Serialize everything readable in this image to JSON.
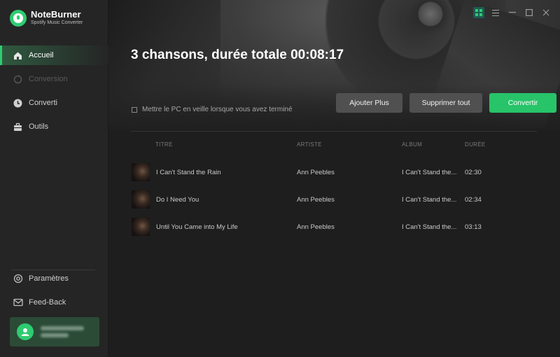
{
  "brand": {
    "name": "NoteBurner",
    "subtitle": "Spotify Music Converter"
  },
  "nav": {
    "accueil": "Accueil",
    "conversion": "Conversion",
    "converti": "Converti",
    "outils": "Outils",
    "parametres": "Paramètres",
    "feedback": "Feed-Back"
  },
  "header": {
    "title": "3 chansons, durée totale 00:08:17"
  },
  "options": {
    "sleep_label": "Mettre le PC en veille lorsque vous avez terminé"
  },
  "buttons": {
    "add_more": "Ajouter Plus",
    "delete_all": "Supprimer tout",
    "convert": "Convertir"
  },
  "table": {
    "columns": [
      "TITRE",
      "ARTISTE",
      "ALBUM",
      "DURÉE"
    ],
    "rows": [
      {
        "title": "I Can't Stand the Rain",
        "artist": "Ann Peebles",
        "album": "I Can't Stand the...",
        "duration": "02:30"
      },
      {
        "title": "Do I Need You",
        "artist": "Ann Peebles",
        "album": "I Can't Stand the...",
        "duration": "02:34"
      },
      {
        "title": "Until You Came into My Life",
        "artist": "Ann Peebles",
        "album": "I Can't Stand the...",
        "duration": "03:13"
      }
    ]
  },
  "colors": {
    "accent": "#2ecc71",
    "button_green": "#27c469",
    "sidebar_bg": "#252525",
    "main_bg": "#1e1e1e"
  },
  "icons": {
    "accueil": "home-icon",
    "conversion": "sync-icon",
    "converti": "clock-icon",
    "outils": "toolbox-icon",
    "parametres": "settings-icon",
    "feedback": "mail-icon",
    "user": "user-icon",
    "window": [
      "grid-icon",
      "menu-icon",
      "minimize-icon",
      "maximize-icon",
      "close-icon"
    ]
  }
}
